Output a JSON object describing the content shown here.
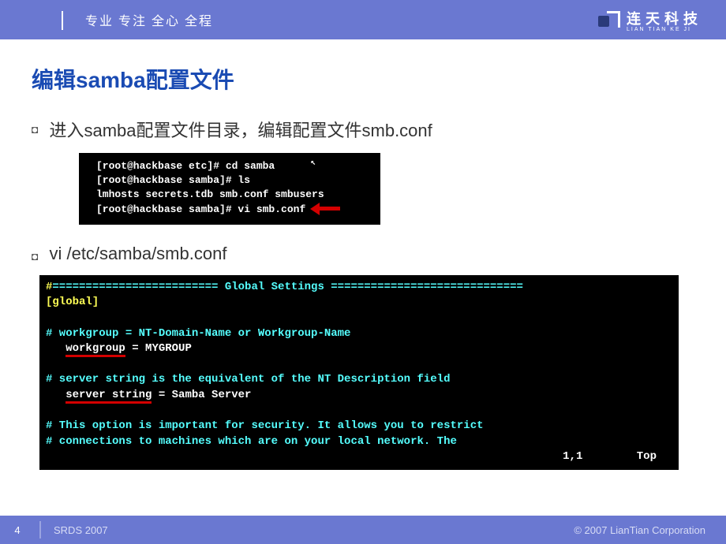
{
  "header": {
    "slogan": "专业 专注 全心 全程",
    "logo_cn": "连天科技",
    "logo_en": "LIAN TIAN KE JI"
  },
  "title": "编辑samba配置文件",
  "bullets": {
    "b1": "进入samba配置文件目录，编辑配置文件smb.conf",
    "b2": "vi  /etc/samba/smb.conf"
  },
  "terminal1": {
    "line1": "[root@hackbase etc]# cd samba",
    "line2": "[root@hackbase samba]# ls",
    "line3": "lmhosts  secrets.tdb  smb.conf  smbusers",
    "line4": "[root@hackbase samba]# vi smb.conf"
  },
  "terminal2": {
    "line1_a": "#",
    "line1_b": "========================= Global Settings =============================",
    "line2": "[global]",
    "line3": "# workgroup = NT-Domain-Name or Workgroup-Name",
    "line4_a": "workgroup",
    "line4_b": " = MYGROUP",
    "line5": "# server string is the equivalent of the NT Description field",
    "line6_a": "server string",
    "line6_b": " = Samba Server",
    "line7": "# This option is important for security. It allows you to restrict",
    "line8": "# connections to machines which are on your local network. The",
    "status_pos": "1,1",
    "status_mode": "Top"
  },
  "footer": {
    "page": "4",
    "conf": "SRDS 2007",
    "copyright": "© 2007 LianTian Corporation"
  }
}
